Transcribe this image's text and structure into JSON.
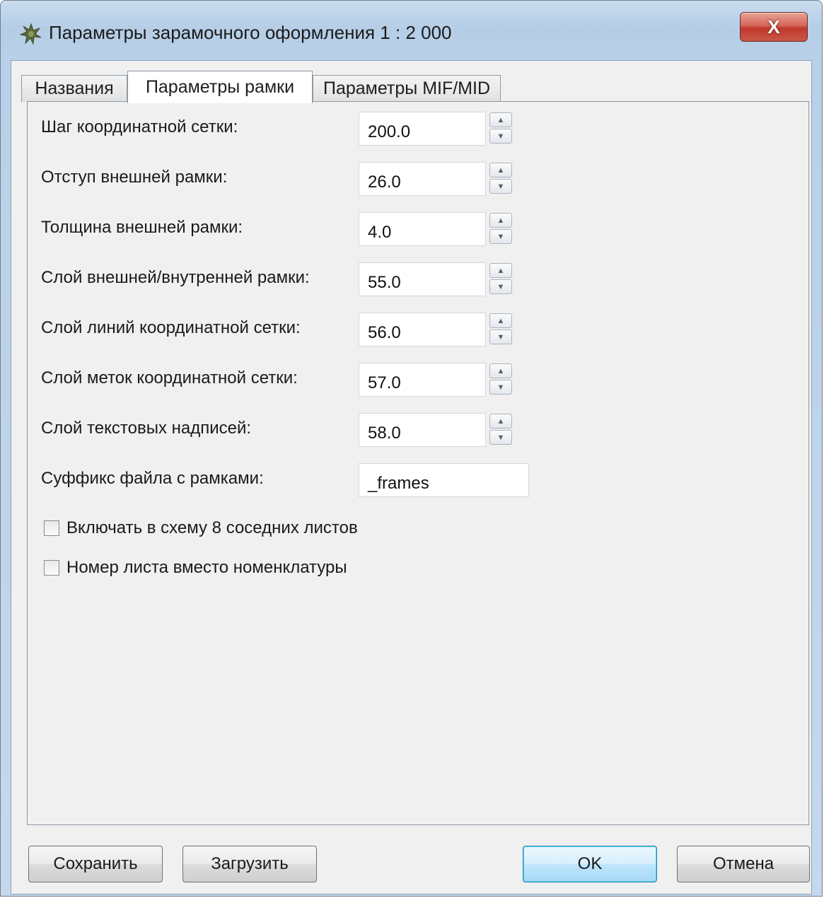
{
  "window": {
    "title": "Параметры зарамочного оформления 1 : 2 000",
    "close_label": "X"
  },
  "tabs": [
    {
      "label": "Названия",
      "active": false
    },
    {
      "label": "Параметры рамки",
      "active": true
    },
    {
      "label": "Параметры MIF/MID",
      "active": false
    }
  ],
  "fields": [
    {
      "label": "Шаг координатной сетки:",
      "value": "200.0"
    },
    {
      "label": "Отступ внешней рамки:",
      "value": "26.0"
    },
    {
      "label": "Толщина внешней рамки:",
      "value": "4.0"
    },
    {
      "label": "Слой внешней/внутренней рамки:",
      "value": "55.0"
    },
    {
      "label": "Слой линий координатной сетки:",
      "value": "56.0"
    },
    {
      "label": "Слой меток координатной сетки:",
      "value": "57.0"
    },
    {
      "label": "Слой текстовых надписей:",
      "value": "58.0"
    }
  ],
  "suffix": {
    "label": "Суффикс файла с рамками:",
    "value": "_frames"
  },
  "checkboxes": [
    {
      "label": "Включать в схему 8 соседних листов",
      "checked": false
    },
    {
      "label": "Номер листа вместо номенклатуры",
      "checked": false
    }
  ],
  "buttons": {
    "save": "Сохранить",
    "load": "Загрузить",
    "ok": "OK",
    "cancel": "Отмена"
  }
}
